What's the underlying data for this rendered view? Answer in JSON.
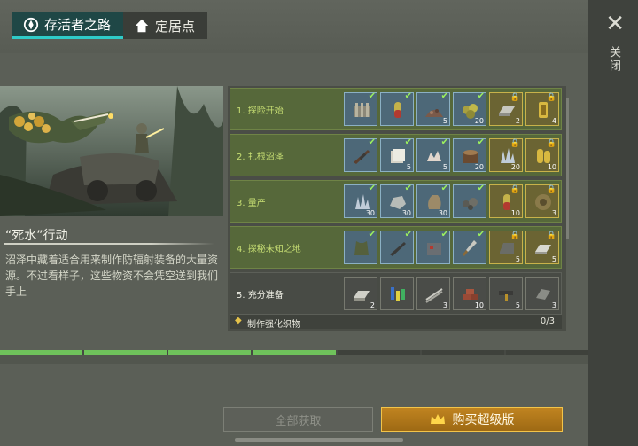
{
  "tabs": [
    {
      "label": "存活者之路",
      "icon": "survivor-emblem-icon",
      "active": true
    },
    {
      "label": "定居点",
      "icon": "house-icon",
      "active": false
    }
  ],
  "close": {
    "label": "关闭",
    "icon": "close-icon"
  },
  "story": {
    "title": "“死水”行动",
    "description": "沼泽中藏着适合用来制作防辐射装备的大量资源。不过看样子，这些物资不会凭空送到我们手上"
  },
  "stages": [
    {
      "label": "1. 探险开始",
      "status": "done",
      "items": [
        {
          "icon": "tool-rack-icon",
          "qty": "",
          "state": "got"
        },
        {
          "icon": "capsule-icon",
          "qty": "",
          "state": "got"
        },
        {
          "icon": "ore-pile-icon",
          "qty": "5",
          "state": "got"
        },
        {
          "icon": "herb-bundle-icon",
          "qty": "20",
          "state": "got"
        },
        {
          "icon": "metal-ingot-icon",
          "qty": "2",
          "state": "lock"
        },
        {
          "icon": "battery-cell-icon",
          "qty": "4",
          "state": "lock"
        }
      ]
    },
    {
      "label": "2. 扎根沼泽",
      "status": "done",
      "items": [
        {
          "icon": "rifle-icon",
          "qty": "",
          "state": "got"
        },
        {
          "icon": "paper-stack-icon",
          "qty": "5",
          "state": "got"
        },
        {
          "icon": "salt-crystal-icon",
          "qty": "5",
          "state": "got"
        },
        {
          "icon": "wood-log-icon",
          "qty": "20",
          "state": "got"
        },
        {
          "icon": "crystal-cluster-icon",
          "qty": "20",
          "state": "lock"
        },
        {
          "icon": "capsule-pile-icon",
          "qty": "10",
          "state": "lock"
        }
      ]
    },
    {
      "label": "3. 量产",
      "status": "done",
      "items": [
        {
          "icon": "crystal-cluster-icon",
          "qty": "30",
          "state": "got"
        },
        {
          "icon": "stone-chunk-icon",
          "qty": "30",
          "state": "got"
        },
        {
          "icon": "fiber-sack-icon",
          "qty": "30",
          "state": "got"
        },
        {
          "icon": "gravel-icon",
          "qty": "",
          "state": "got"
        },
        {
          "icon": "capsule-pile-icon",
          "qty": "10",
          "state": "lock"
        },
        {
          "icon": "mine-disc-icon",
          "qty": "3",
          "state": "lock"
        }
      ]
    },
    {
      "label": "4. 探秘未知之地",
      "status": "done",
      "items": [
        {
          "icon": "armor-vest-icon",
          "qty": "",
          "state": "got"
        },
        {
          "icon": "rifle-icon",
          "qty": "",
          "state": "got"
        },
        {
          "icon": "machine-part-icon",
          "qty": "",
          "state": "got"
        },
        {
          "icon": "knife-icon",
          "qty": "",
          "state": "got"
        },
        {
          "icon": "metal-plate-icon",
          "qty": "5",
          "state": "lock"
        },
        {
          "icon": "metal-ingot-icon",
          "qty": "5",
          "state": "lock"
        }
      ]
    },
    {
      "label": "5. 充分准备",
      "status": "open",
      "items": [
        {
          "icon": "metal-ingot-icon",
          "qty": "2",
          "state": "plain"
        },
        {
          "icon": "component-set-icon",
          "qty": "",
          "state": "plain"
        },
        {
          "icon": "rod-set-icon",
          "qty": "3",
          "state": "plain"
        },
        {
          "icon": "brick-stack-icon",
          "qty": "10",
          "state": "plain"
        },
        {
          "icon": "smg-icon",
          "qty": "5",
          "state": "plain"
        },
        {
          "icon": "metal-roll-icon",
          "qty": "3",
          "state": "plain"
        }
      ]
    }
  ],
  "task": {
    "label": "制作强化织物",
    "count": "0/3"
  },
  "progress": {
    "segments_total": 7,
    "segments_done": 4
  },
  "buttons": {
    "claim_all": "全部获取",
    "buy_super": "购买超级版"
  },
  "colors": {
    "accent_teal": "#2fcbc8",
    "done_green": "#56683a",
    "gold": "#f2c44a",
    "progress_green": "#6fc25b"
  }
}
